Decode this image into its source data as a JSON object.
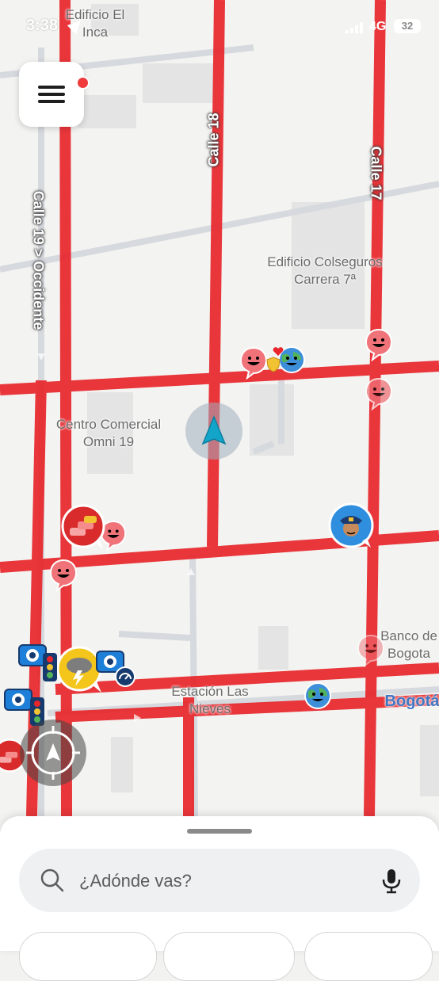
{
  "status_bar": {
    "time": "3:38",
    "network": "4G",
    "battery": "32"
  },
  "map": {
    "place_labels": [
      {
        "id": "edificio-el-inca",
        "text": "Edificio El Inca"
      },
      {
        "id": "edificio-colseguros",
        "text": "Edificio Colseguros Carrera 7ª"
      },
      {
        "id": "centro-comercial",
        "text": "Centro Comercial Omni 19"
      },
      {
        "id": "estacion-nieves",
        "text": "Estación Las Nieves"
      },
      {
        "id": "banco-bogota",
        "text": "Banco de Bogota"
      },
      {
        "id": "bogota",
        "text": "Bogotá"
      }
    ],
    "street_labels": {
      "calle_19": "Calle 19 > Occidente",
      "calle_18": "Calle 18",
      "calle_17": "Calle 17"
    },
    "traffic_color": "#e8262b",
    "icons": [
      "menu-icon",
      "navigation-arrow-icon",
      "recenter-icon",
      "search-icon",
      "microphone-icon",
      "police-icon",
      "traffic-jam-icon",
      "weather-storm-icon",
      "speed-camera-icon",
      "traffic-light-icon",
      "wazer-icon"
    ]
  },
  "search": {
    "placeholder": "¿Adónde vas?"
  }
}
